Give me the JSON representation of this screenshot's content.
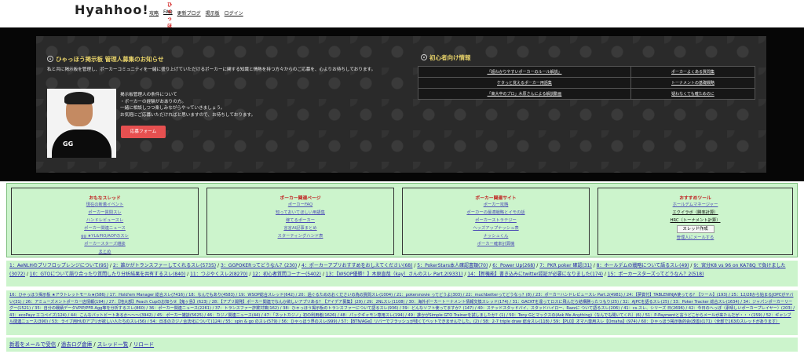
{
  "header": {
    "logo": "Hyahhoo!",
    "logo_tag": "ひゃっほう",
    "nav": [
      "攻略",
      "FAQ",
      "更新ブログ",
      "掲示板",
      "ログイン"
    ]
  },
  "recruit": {
    "title": "ひゃっほう掲示板 管理人募集のお知らせ",
    "intro": "私と共に掲示板を管理し、ポーカーコミュニティを一緒に盛り上げていただけるポーカーに関する知識と情熱を持つ方々からのご応募を、心よりお待ちしております。",
    "lines": [
      "掲示板管理人の条件について",
      "・ポーカーの経験がおありの方。",
      "一緒に相談しつつ楽しみながらやっていきましょう。",
      "お気軽にご応募いただければと思いますので、お待ちしております。"
    ],
    "apply": "応募フォーム"
  },
  "beginner": {
    "title": "初心者向け情報",
    "rows": [
      [
        "「超わかりやすいポーカーのルール解説」",
        "ポーカーよくある質問集"
      ],
      [
        "ケタっと覚えるポーカー用語集",
        "トーナメントの基礎戦略"
      ],
      [
        "「東大卒のプロ」木原さんによる解説動画",
        "疑わなくても確ためのに"
      ]
    ]
  },
  "boxes": [
    {
      "title": "おもなスレッド",
      "items": [
        "現在の新着イベント",
        "ポーカー質問スレ",
        "ハンドレビュースレ",
        "ポーカー関連ニュース",
        "gg ★YL&PIO/AOFのスレ",
        "ポーカースターズ雑談",
        "まとめ"
      ]
    },
    {
      "title": "ポーカー関連ページ",
      "items": [
        "ポーカーFAQ",
        "知っておいてほしい用語集",
        "稼てるポーカー",
        "言言AI記事まとめ",
        "スターティングハンド表"
      ]
    },
    {
      "title": "ポーカー関連サイト",
      "items": [
        "ポーカー攻略",
        "ポーカーの最適戦略とイモの話",
        "ポーカーストラテジー",
        "ヘッズアップナッシュ表",
        "ナッシュくん",
        "ポーカー確率計算機"
      ]
    },
    {
      "title": "おすすめツール",
      "items": [
        "ホールデムマネージャー",
        "エクイラボ（勝率計算）",
        "HRC（トーナメント計算）"
      ],
      "button": "スレッド作成",
      "footer_link": "管理人にメールする"
    }
  ],
  "threads1": [
    "1：AeNLHのプリフロップレンジについて(95)",
    "2：誰かがトランスファーしてくれるスレ(5735)",
    "3：GGPOKERってどうなん？(230)",
    "4：ポーカーアプリおすすめをおしえてください(68)",
    "5：PokerStars本人確認書類(70)",
    "6：Power Up(268)",
    "7：PKR poker 確認(31)",
    "8：ホールデムの戦略について語るスレ(49)",
    "9：宮分K8 vs 96 on KA78Q で負けました(3072)",
    "10：GTOについて語り合ったり質問したり分析結果を共有するスレ(840)",
    "11：つぶやくスレ2(8270)",
    "12：初心者質問コーナー(5402)",
    "13：【WSOP優勝！】木原直哉（kay）さんのスレ Part.2(9331)",
    "14：【新機能】書き込みにtwitter認証が必要になりました(174)",
    "15：ポーカースターズってどうなん？2(518)"
  ],
  "threads2_text": "16：ひゃっほう揭示板 ★アウトレットモール★(586) / 17：Hold'em Manager 総合スレ(7416) / 18：なんでもあり(4583) / 19：WSOP総合スレッド(642) / 20：過ぐるためのおくださいの為の質問スレ(1004) / 21：pokersnovie ってどうよ(303) / 22：muchbetterってどうなっ？(8) / 23：ポーカーハンドレビュースレ Part.2(4981) / 24：【夢賞付】TABLENINJA使ってる？【ツール】(193) / 25：12/28から始まるJOPCがヤバい(31) / 26：アミューズメントポーカー店情報(194) / 27：【地大部】Peach Cupのお知らせ【鬼ヶ島】(623) / 28：【アプリ開発】ポーカー関連でなんか欲しいアプリある？【アイデア募集】(29) / 29：2NLスレ(1108) / 30：海外ポーカートーナメント情報交換スレッド(174) / 31：GACKTを違ってロスに飛んだら結構勝ったつもり(25) / 32：AJPCを語るスレ(25) / 33：Poker Tracker 総合スレ(1634) / 34：ジャパンポーカーリーグー(1521) / 35：自分の戦績データVPIP/PFR Agg等を分析するスレ(860) / 36：ポーカー関連ニュース(2261) / 37：トランスファー詐欺対策(162) / 38：ひゃっほう掲示板のトランスファーについて語るスレ(936) / 39：どんなソフト使ってますか？(147) / 40：ステッドスタッドバイ、スタッドハイロー、Razzに ついて語るスレ(206) / 41：cs.スレ、シリーズ 日(2696) / 42：今日のへっぽ（素晴しいポーカープレイヤー）(203) / 43：ecoPayz エコペイズ(124) / 44：こんなバットビートあるか〜〜〜(3942) / 45：ポーカー雑談(5625) / 46：カジノ関連ニュース(44) / 47：「ネットカジノ」初の利用者(1626) / 48：パックギャモン専用スレ(194) / 49：誰かがSimple GTO Trainerを試しましたか？(1) / 50：Tony Gとマックスの(Ask Me Anything)（なんでも聞いてくれ）(6) / 51：P-Paymentと言うどこからメールが来たんだが・・・(159) / 52：ギャンブル関連ニュース(390) / 53：ライブ用HUDアプリが欲しい人たちのスレ(56) / 54：日本のカジノ合法化について(124) / 55：spin & go のスレ(579) / 56：ひゃっほう界のスレ(999) / 57：【BTN/AGe】リバーでフラッシュが残くてベットできませんでした。(2) / 58：2-7 triple draw 総合スレ(118) / 59：【PLO】オマハ専用スレ【Omaha】(974) / 60：ひゃっほう掲示板的会(改善)(171)（全部で163のスレッドがあります）",
  "footer": [
    "新着をメールで受信",
    "過去ログ倉庫",
    "スレッド一覧",
    "リロード"
  ]
}
